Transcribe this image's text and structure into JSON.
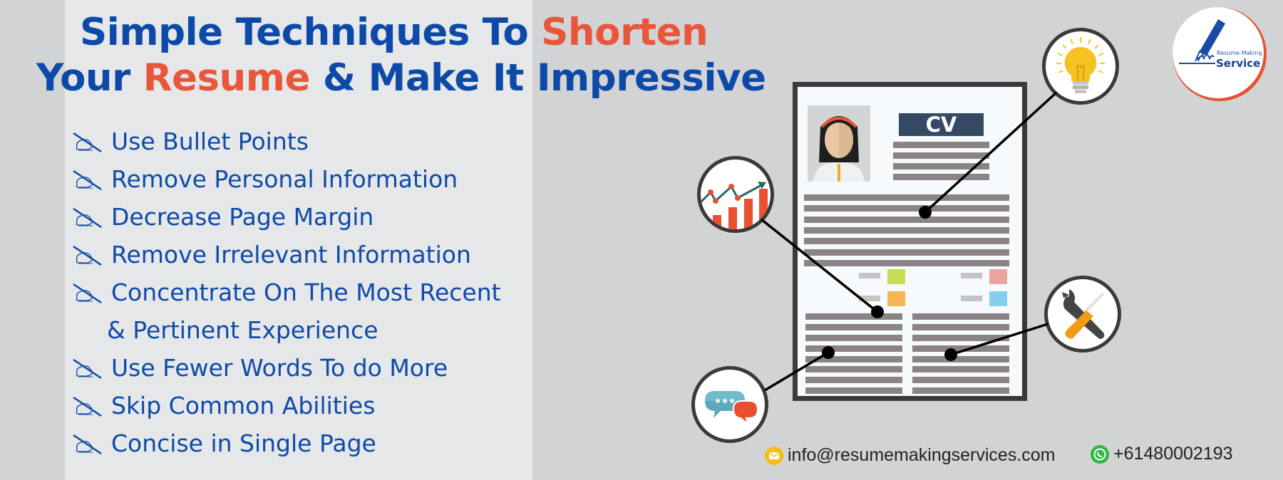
{
  "title": {
    "line1_part1": "Simple Techniques To ",
    "line1_accent": "Shorten",
    "line2_part1": "Your ",
    "line2_accent": "Resume",
    "line2_part2": " & Make It Impressive"
  },
  "techniques": {
    "bullet_icon": "writing-hand-icon",
    "items": [
      "Use Bullet Points",
      "Remove Personal Information",
      "Decrease Page Margin",
      "Remove Irrelevant Information",
      "Concentrate On The Most Recent",
      "& Pertinent Experience",
      "Use Fewer Words To do More",
      "Skip Common Abilities",
      "Concise in Single Page"
    ]
  },
  "illustration": {
    "cv_label": "CV",
    "callout_icons": [
      "growth-chart-icon",
      "lightbulb-icon",
      "tools-icon",
      "chat-bubbles-icon"
    ],
    "colors": {
      "frame": "#3a3a3a",
      "cv_label_bg": "#344a64",
      "swatch_green": "#c7dc52",
      "swatch_orange": "#f4b552",
      "swatch_pink": "#eba5a0",
      "swatch_blue": "#82cfee"
    }
  },
  "logo": {
    "line1": "Resume Making",
    "line2": "Service"
  },
  "contact": {
    "email": "info@resumemakingservices.com",
    "phone": "+61480002193"
  },
  "colors": {
    "primary": "#0d4aa8",
    "accent": "#e8573a",
    "background": "#d2d3d5",
    "panel": "#e6e7e9"
  }
}
